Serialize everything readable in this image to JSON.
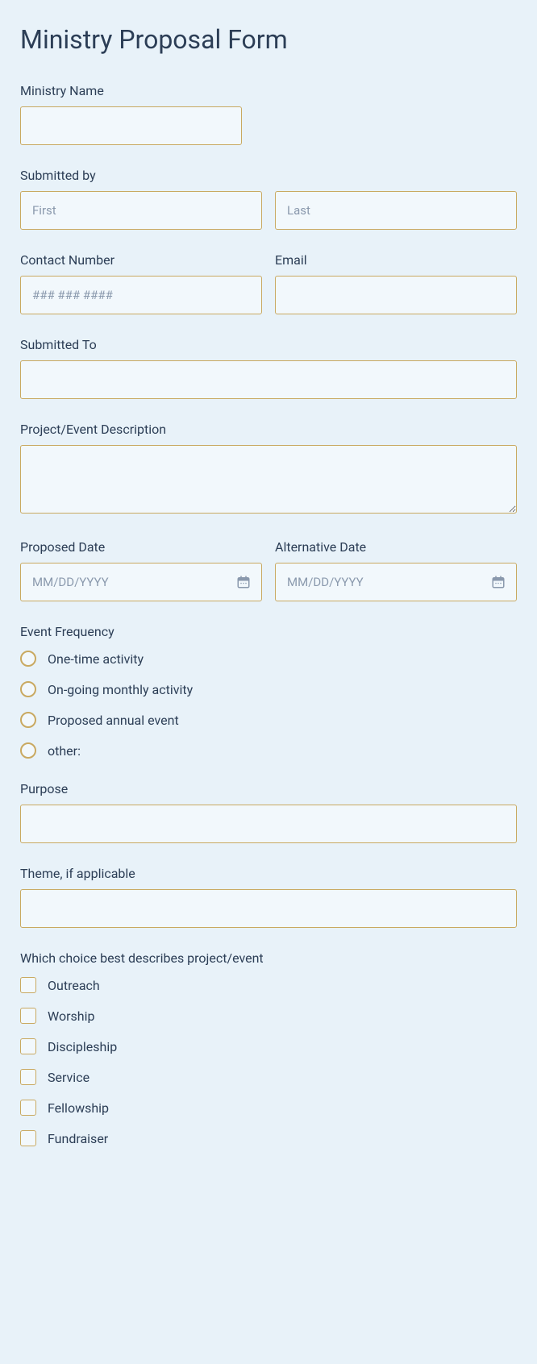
{
  "title": "Ministry Proposal Form",
  "fields": {
    "ministryName": {
      "label": "Ministry Name"
    },
    "submittedBy": {
      "label": "Submitted by",
      "firstPlaceholder": "First",
      "lastPlaceholder": "Last"
    },
    "contact": {
      "label": "Contact Number",
      "placeholder": "### ### ####"
    },
    "email": {
      "label": "Email"
    },
    "submittedTo": {
      "label": "Submitted To"
    },
    "description": {
      "label": "Project/Event Description"
    },
    "proposedDate": {
      "label": "Proposed Date",
      "placeholder": "MM/DD/YYYY"
    },
    "altDate": {
      "label": "Alternative Date",
      "placeholder": "MM/DD/YYYY"
    },
    "frequency": {
      "label": "Event Frequency",
      "options": [
        "One-time activity",
        "On-going monthly activity",
        "Proposed annual event",
        "other:"
      ]
    },
    "purpose": {
      "label": "Purpose"
    },
    "theme": {
      "label": "Theme, if applicable"
    },
    "describes": {
      "label": "Which choice best describes project/event",
      "options": [
        "Outreach",
        "Worship",
        "Discipleship",
        "Service",
        "Fellowship",
        "Fundraiser"
      ]
    }
  }
}
